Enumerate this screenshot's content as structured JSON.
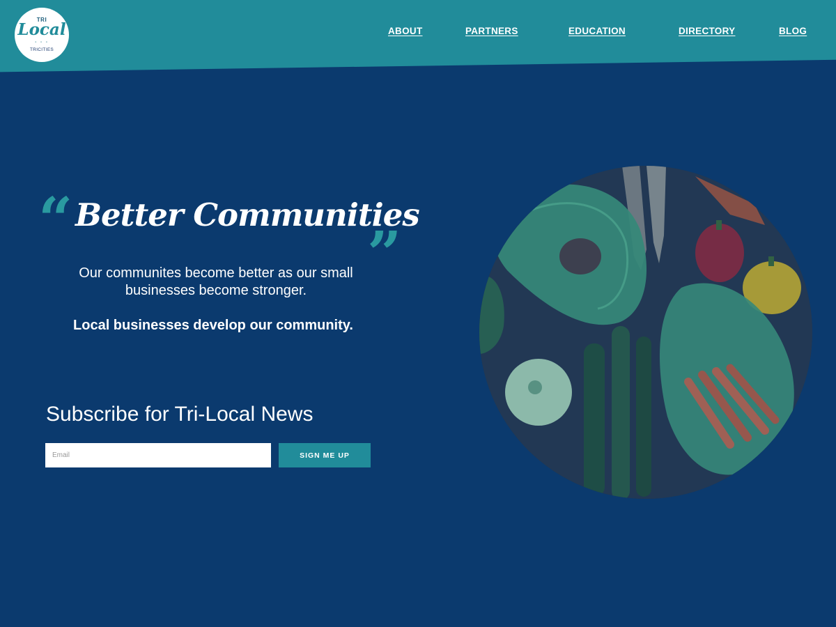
{
  "logo": {
    "top": "TRI",
    "main": "Local",
    "bottom": "TRICITIES"
  },
  "nav": {
    "items": [
      {
        "label": "ABOUT"
      },
      {
        "label": "PARTNERS"
      },
      {
        "label": "EDUCATION"
      },
      {
        "label": "DIRECTORY"
      },
      {
        "label": "BLOG"
      }
    ]
  },
  "hero": {
    "open_quote": "“",
    "close_quote": "”",
    "title": "Better Communities",
    "text": "Our communites become better as our small businesses become stronger.",
    "bold_text": "Local businesses develop our community."
  },
  "subscribe": {
    "title": "Subscribe for Tri-Local News",
    "email_placeholder": "Email",
    "button_label": "SIGN ME UP"
  },
  "colors": {
    "header": "#218c9a",
    "background": "#0b3a6e",
    "accent": "#2a9aa0",
    "button": "#218c9a"
  }
}
